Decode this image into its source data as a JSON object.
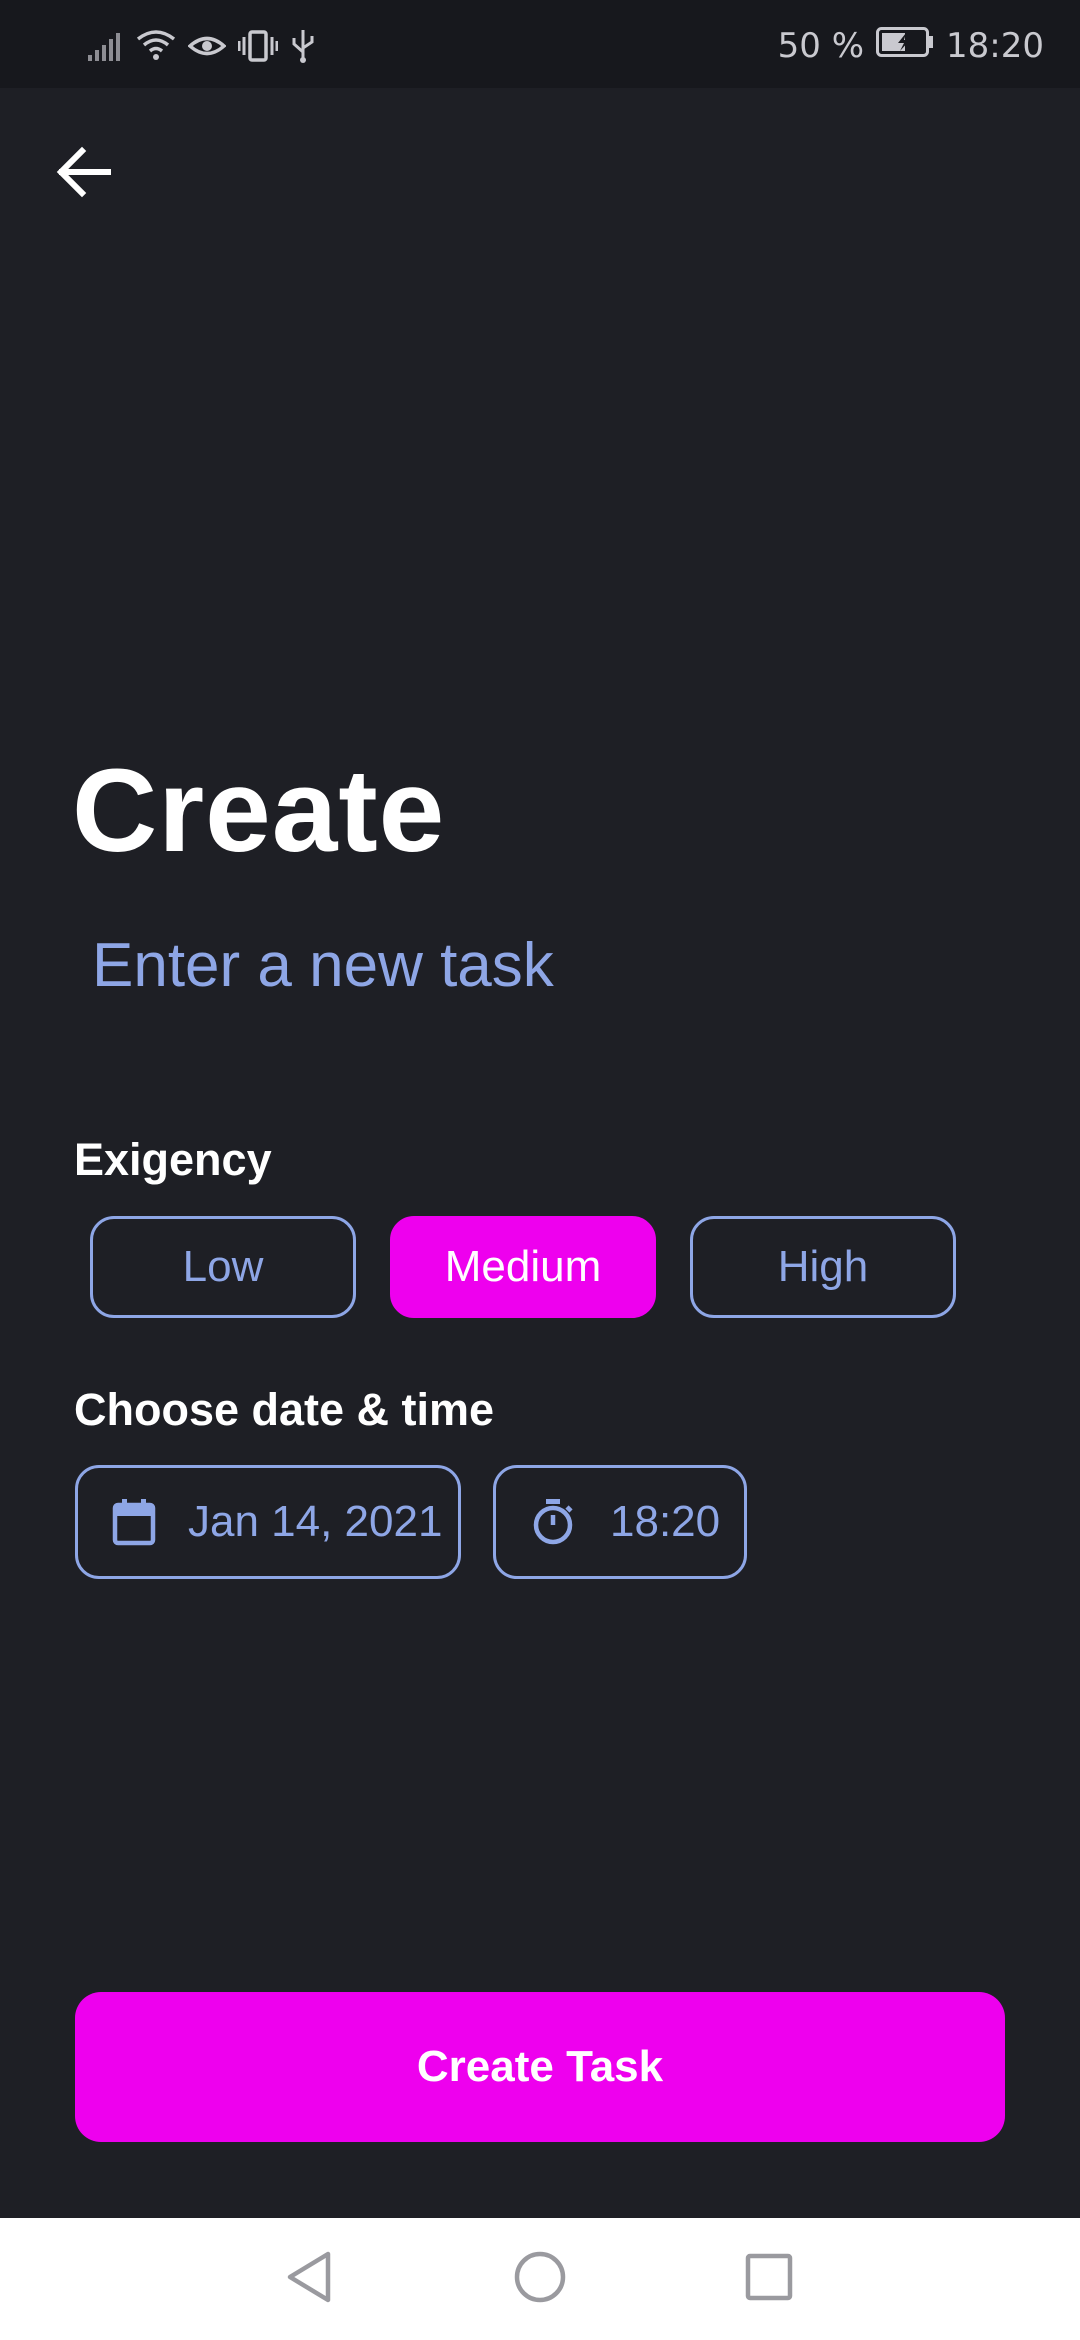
{
  "status_bar": {
    "battery_percent": "50 %",
    "time": "18:20",
    "icons": [
      "signal-icon",
      "wifi-icon",
      "eye-comfort-icon",
      "vibrate-icon",
      "usb-icon",
      "battery-charging-icon"
    ]
  },
  "app_bar": {
    "back_icon": "arrow-left-icon"
  },
  "header": {
    "title": "Create"
  },
  "task_input": {
    "placeholder": "Enter a new task",
    "value": ""
  },
  "exigency": {
    "label": "Exigency",
    "options": [
      {
        "label": "Low",
        "selected": false
      },
      {
        "label": "Medium",
        "selected": true
      },
      {
        "label": "High",
        "selected": false
      }
    ]
  },
  "datetime": {
    "label": "Choose date & time",
    "date": {
      "icon": "calendar-icon",
      "value": "Jan 14, 2021"
    },
    "time": {
      "icon": "stopwatch-icon",
      "value": "18:20"
    }
  },
  "actions": {
    "create_label": "Create Task"
  },
  "nav_bar": {
    "icons": [
      "nav-back-icon",
      "nav-home-icon",
      "nav-recents-icon"
    ]
  },
  "colors": {
    "background": "#1e1f25",
    "accent": "#ee00ee",
    "outline": "#8ea6e6",
    "text": "#ffffff"
  }
}
